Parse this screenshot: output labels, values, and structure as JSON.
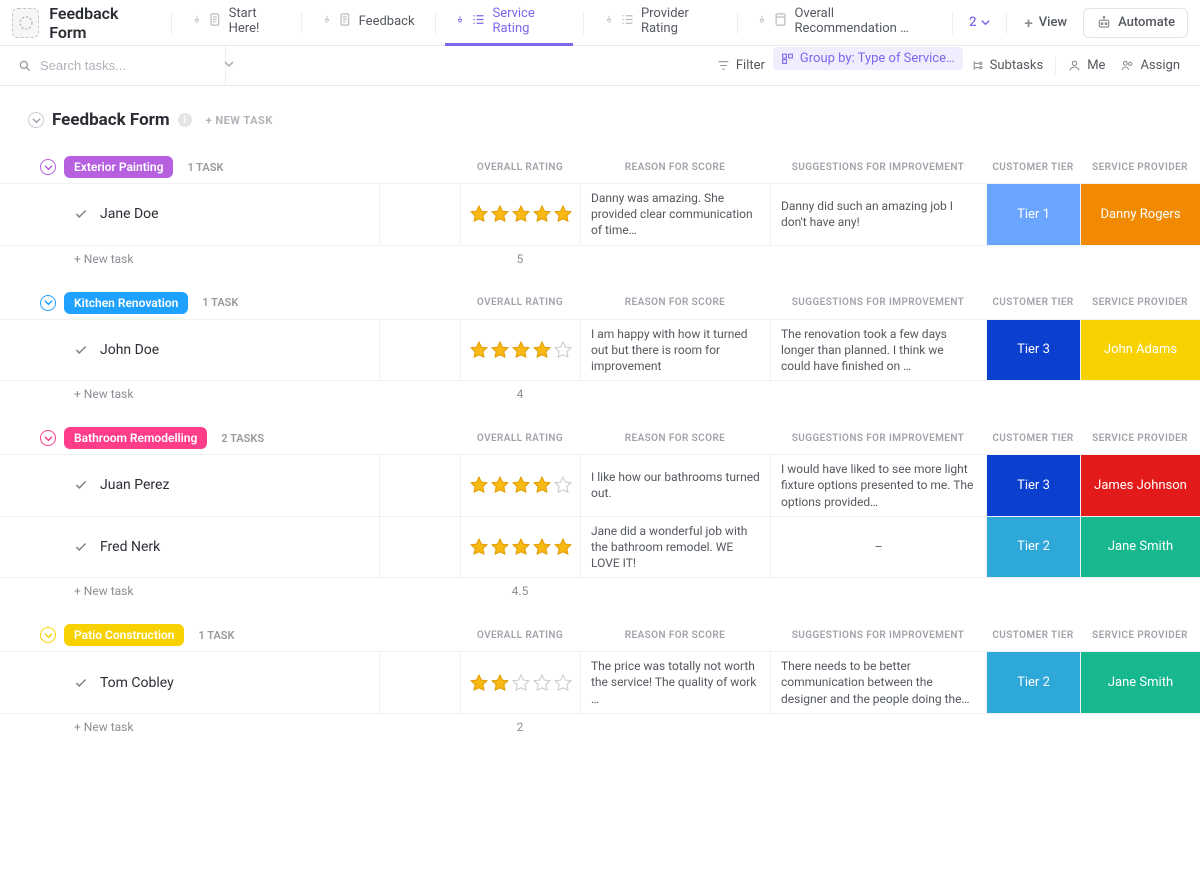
{
  "header": {
    "app_title": "Feedback Form",
    "tabs": [
      {
        "label": "Start Here!",
        "icon": "doc"
      },
      {
        "label": "Feedback",
        "icon": "doc"
      },
      {
        "label": "Service Rating",
        "icon": "list",
        "active": true
      },
      {
        "label": "Provider Rating",
        "icon": "list"
      },
      {
        "label": "Overall Recommendation …",
        "icon": "page"
      }
    ],
    "more_count": "2",
    "add_view_label": "View",
    "automate_label": "Automate"
  },
  "filterbar": {
    "search_placeholder": "Search tasks...",
    "filter_label": "Filter",
    "group_label": "Group by: Type of Service…",
    "subtasks_label": "Subtasks",
    "me_label": "Me",
    "assign_label": "Assign"
  },
  "list": {
    "title": "Feedback Form",
    "new_task_top": "+ NEW TASK",
    "new_task_row": "+ New task",
    "columns": {
      "rating": "OVERALL RATING",
      "reason": "REASON FOR SCORE",
      "suggestions": "SUGGESTIONS FOR IMPROVEMENT",
      "tier": "CUSTOMER TIER",
      "provider": "SERVICE PROVIDER"
    }
  },
  "tier_colors": {
    "Tier 1": "#6aa6ff",
    "Tier 2": "#2ea7d9",
    "Tier 3": "#0b3fce"
  },
  "groups": [
    {
      "name": "Exterior Painting",
      "color": "#b660e0",
      "count_label": "1 TASK",
      "avg": "5",
      "tasks": [
        {
          "name": "Jane Doe",
          "rating": 5,
          "reason": "Danny was amazing. She provided clear communication of time…",
          "suggestions": "Danny did such an amazing job I don't have any!",
          "tier": "Tier 1",
          "provider": "Danny Rogers",
          "provider_color": "#f18a00"
        }
      ]
    },
    {
      "name": "Kitchen Renovation",
      "color": "#1fa1ff",
      "count_label": "1 TASK",
      "avg": "4",
      "tasks": [
        {
          "name": "John Doe",
          "rating": 4,
          "reason": "I am happy with how it turned out but there is room for improvement",
          "suggestions": "The renovation took a few days longer than planned. I think we could have finished on …",
          "tier": "Tier 3",
          "provider": "John Adams",
          "provider_color": "#f7d200"
        }
      ]
    },
    {
      "name": "Bathroom Remodelling",
      "color": "#ff3d8b",
      "count_label": "2 TASKS",
      "avg": "4.5",
      "tasks": [
        {
          "name": "Juan Perez",
          "rating": 4,
          "reason": "I like how our bathrooms turned out.",
          "suggestions": "I would have liked to see more light fixture options presented to me. The options provided…",
          "tier": "Tier 3",
          "provider": "James Johnson",
          "provider_color": "#e21a1a"
        },
        {
          "name": "Fred Nerk",
          "rating": 5,
          "reason": "Jane did a wonderful job with the bathroom remodel. WE LOVE IT!",
          "suggestions": "–",
          "tier": "Tier 2",
          "provider": "Jane Smith",
          "provider_color": "#17b890"
        }
      ]
    },
    {
      "name": "Patio Construction",
      "color": "#f7d200",
      "count_label": "1 TASK",
      "avg": "2",
      "tasks": [
        {
          "name": "Tom Cobley",
          "rating": 2,
          "reason": "The price was totally not worth the service! The quality of work …",
          "suggestions": "There needs to be better communication between the designer and the people doing the…",
          "tier": "Tier 2",
          "provider": "Jane Smith",
          "provider_color": "#17b890"
        }
      ]
    }
  ]
}
